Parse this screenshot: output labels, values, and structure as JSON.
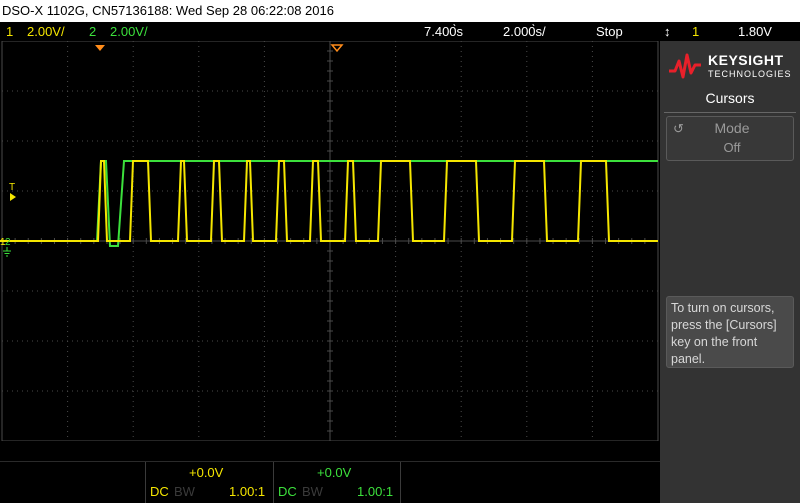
{
  "title_bar": "DSO-X 1102G, CN57136188: Wed Sep 28 06:22:08 2016",
  "status": {
    "ch1_number": "1",
    "ch1_scale": "2.00V/",
    "ch2_number": "2",
    "ch2_scale": "2.00V/",
    "time_position": "7.400̀s",
    "time_per_div": "2.000̀s/",
    "run_state": "Stop",
    "trigger_icon": "↕",
    "trigger_source": "1",
    "trigger_level": "1.80V"
  },
  "colors": {
    "ch1": "#f5e600",
    "ch2": "#3ce03c",
    "grid": "#4a4a4a",
    "marker": "#ff8c1a"
  },
  "markers": {
    "trigger_label": "T",
    "ch1_ground_label": "1",
    "ch2_ground_label": "2"
  },
  "panel": {
    "brand": "KEYSIGHT",
    "brand_sub": "TECHNOLOGIES",
    "menu_title": "Cursors",
    "mode_label": "Mode",
    "mode_value": "Off",
    "hint": "To turn on cursors, press the [Cursors] key on the front panel."
  },
  "channels": [
    {
      "offset": "+0.0V",
      "coupling": "DC",
      "bw_limit": "BW",
      "probe": "1.00:1"
    },
    {
      "offset": "+0.0V",
      "coupling": "DC",
      "bw_limit": "BW",
      "probe": "1.00:1"
    }
  ],
  "waveform": {
    "ch1_levels": "low,high,low,high,low,high,low,high,...",
    "ch2_levels": "low,high"
  }
}
